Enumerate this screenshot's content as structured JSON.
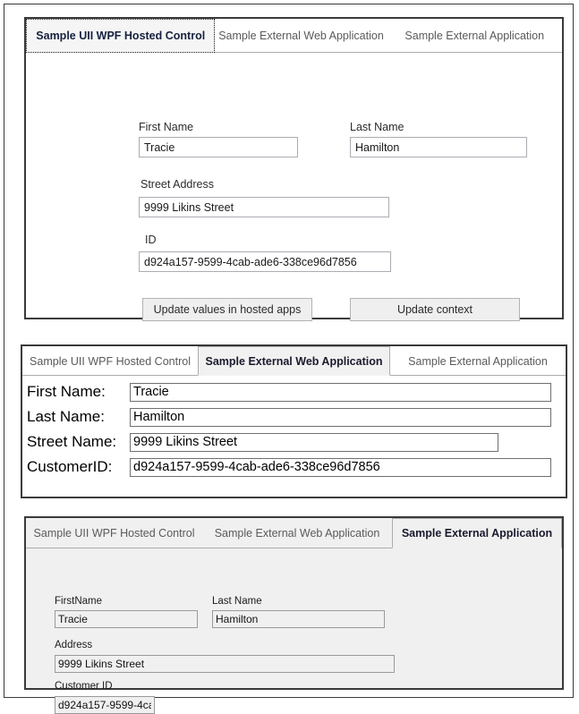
{
  "tabs": {
    "wpf": "Sample UII WPF Hosted Control",
    "web": "Sample External Web Application",
    "ext": "Sample External Application"
  },
  "panel_wpf": {
    "active_tab": "Sample UII WPF Hosted Control",
    "fields": {
      "first_name_label": "First Name",
      "first_name_value": "Tracie",
      "last_name_label": "Last Name",
      "last_name_value": "Hamilton",
      "street_label": "Street Address",
      "street_value": "9999 Likins Street",
      "id_label": "ID",
      "id_value": "d924a157-9599-4cab-ade6-338ce96d7856"
    },
    "buttons": {
      "update_values": "Update values in hosted apps",
      "update_context": "Update context"
    }
  },
  "panel_web": {
    "active_tab": "Sample External Web Application",
    "fields": {
      "first_name_label": "First Name:",
      "first_name_value": "Tracie",
      "last_name_label": "Last Name:",
      "last_name_value": "Hamilton",
      "street_label": "Street Name:",
      "street_value": "9999 Likins Street",
      "customer_id_label": "CustomerID:",
      "customer_id_value": "d924a157-9599-4cab-ade6-338ce96d7856"
    }
  },
  "panel_ext": {
    "active_tab": "Sample External Application",
    "fields": {
      "first_name_label": "FirstName",
      "first_name_value": "Tracie",
      "last_name_label": "Last Name",
      "last_name_value": "Hamilton",
      "address_label": "Address",
      "address_value": "9999 Likins Street",
      "customer_id_label": "Customer ID",
      "customer_id_value": "d924a157-9599-4ca"
    }
  },
  "colors": {
    "frame_border": "#3a3a3a",
    "tab_inactive_text": "#5a5a5a",
    "tab_active_text": "#16213e",
    "panel_ext_bg": "#f0f0f0",
    "button_bg": "#efefef"
  }
}
